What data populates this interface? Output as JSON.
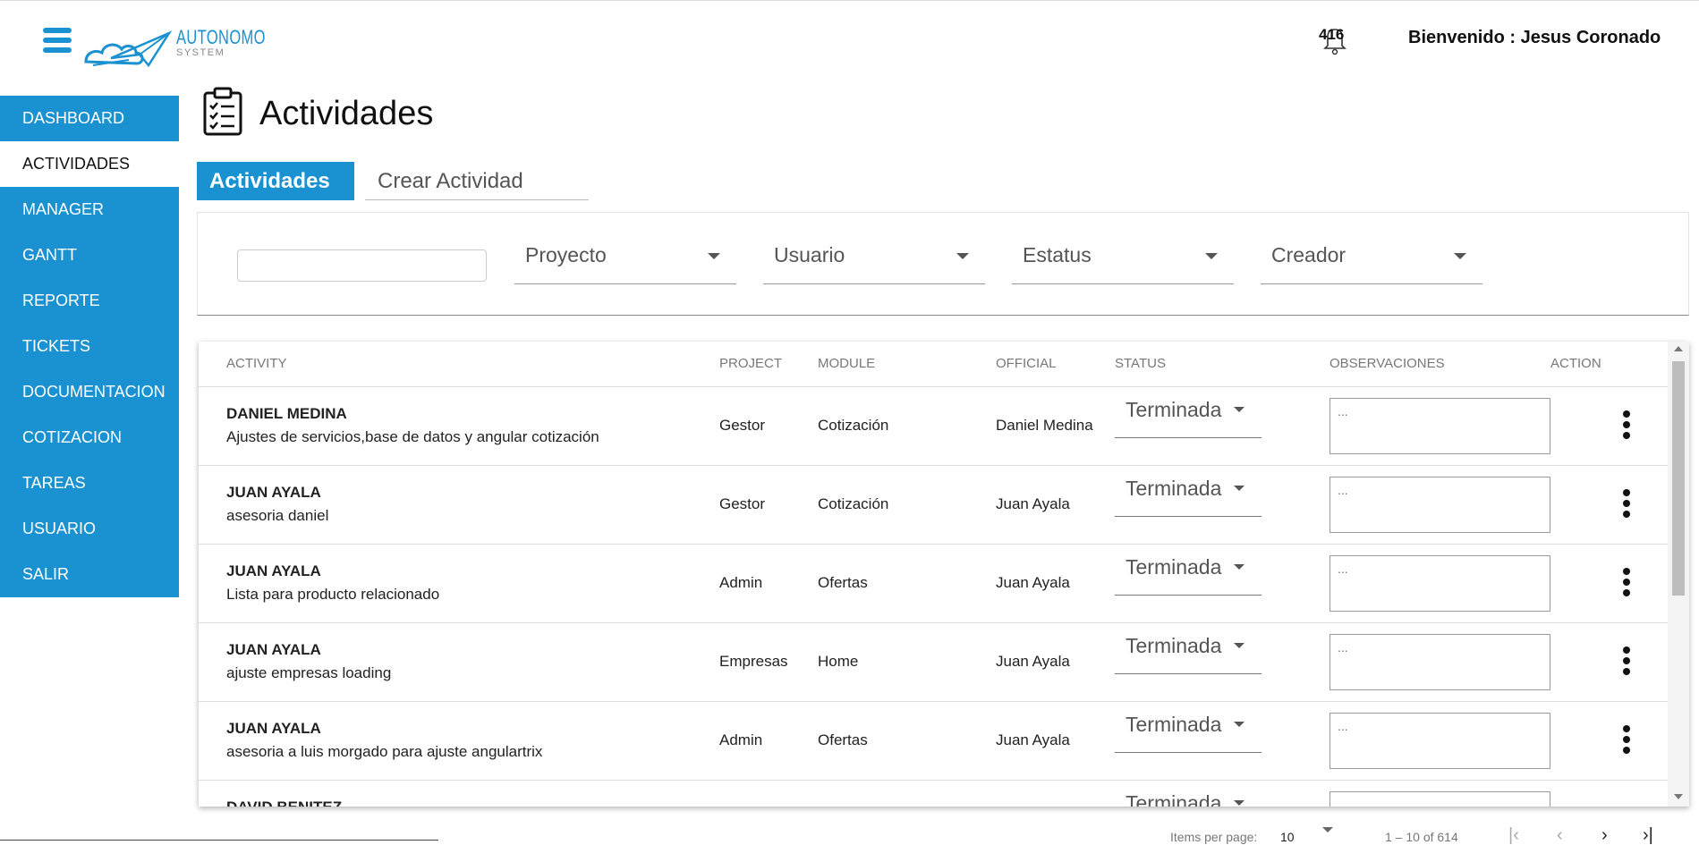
{
  "header": {
    "logo": {
      "name": "AUTONOMO",
      "sub": "SYSTEM"
    },
    "notifications_count": "416",
    "welcome_text": "Bienvenido : Jesus Coronado"
  },
  "sidebar": {
    "items": [
      {
        "label": "DASHBOARD",
        "active": false
      },
      {
        "label": "ACTIVIDADES",
        "active": true
      },
      {
        "label": "MANAGER",
        "active": false
      },
      {
        "label": "GANTT",
        "active": false
      },
      {
        "label": "REPORTE",
        "active": false
      },
      {
        "label": "TICKETS",
        "active": false
      },
      {
        "label": "DOCUMENTACION",
        "active": false
      },
      {
        "label": "COTIZACION",
        "active": false
      },
      {
        "label": "TAREAS",
        "active": false
      },
      {
        "label": "USUARIO",
        "active": false
      },
      {
        "label": "SALIR",
        "active": false
      }
    ]
  },
  "page": {
    "title": "Actividades"
  },
  "tabs": [
    {
      "label": "Actividades",
      "active": true
    },
    {
      "label": "Crear Actividad",
      "active": false
    }
  ],
  "filters": {
    "search_value": "",
    "project": "Proyecto",
    "user": "Usuario",
    "status": "Estatus",
    "creator": "Creador"
  },
  "table": {
    "headers": {
      "activity": "ACTIVITY",
      "project": "PROJECT",
      "module": "MODULE",
      "official": "OFFICIAL",
      "status": "STATUS",
      "observations": "OBSERVACIONES",
      "action": "ACTION"
    },
    "rows": [
      {
        "name": "DANIEL MEDINA",
        "description": "Ajustes de servicios,base de datos y angular cotización",
        "project": "Gestor",
        "module": "Cotización",
        "official": "Daniel Medina",
        "status": "Terminada",
        "observation_placeholder": "..."
      },
      {
        "name": "JUAN AYALA",
        "description": "asesoria daniel",
        "project": "Gestor",
        "module": "Cotización",
        "official": "Juan Ayala",
        "status": "Terminada",
        "observation_placeholder": "..."
      },
      {
        "name": "JUAN AYALA",
        "description": "Lista para producto relacionado",
        "project": "Admin",
        "module": "Ofertas",
        "official": "Juan Ayala",
        "status": "Terminada",
        "observation_placeholder": "..."
      },
      {
        "name": "JUAN AYALA",
        "description": "ajuste empresas loading",
        "project": "Empresas",
        "module": "Home",
        "official": "Juan Ayala",
        "status": "Terminada",
        "observation_placeholder": "..."
      },
      {
        "name": "JUAN AYALA",
        "description": "asesoria a luis morgado para ajuste angulartrix",
        "project": "Admin",
        "module": "Ofertas",
        "official": "Juan Ayala",
        "status": "Terminada",
        "observation_placeholder": "..."
      },
      {
        "name": "DAVID BENITEZ",
        "description": "",
        "project": "",
        "module": "",
        "official": "",
        "status": "Terminada",
        "observation_placeholder": ""
      }
    ]
  },
  "paginator": {
    "items_per_page_label": "Items per page:",
    "page_size": "10",
    "range": "1 – 10 of 614"
  },
  "colors": {
    "accent": "#1a91d1"
  },
  "icons": [
    "menu-icon",
    "paper-plane-logo-icon",
    "bell-icon",
    "clipboard-check-icon",
    "chevron-down-icon",
    "more-vert-icon",
    "first-page-icon",
    "prev-page-icon",
    "next-page-icon",
    "last-page-icon"
  ]
}
